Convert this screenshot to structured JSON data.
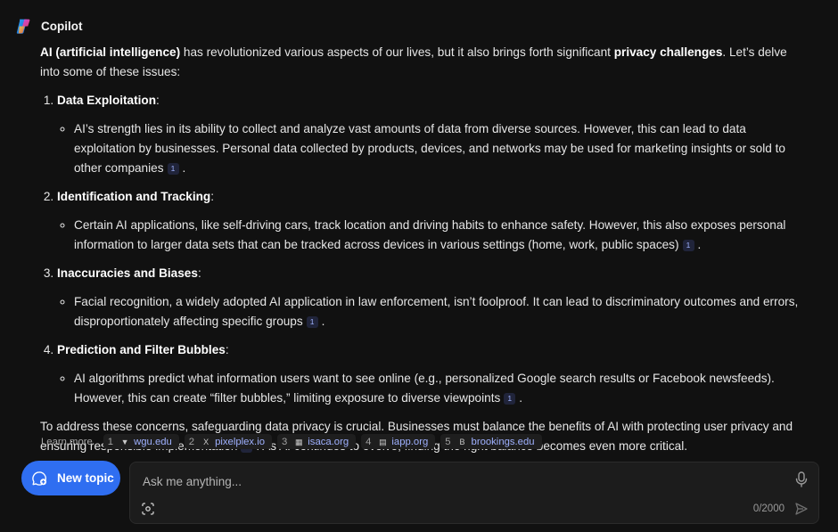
{
  "app": {
    "name": "Copilot"
  },
  "message": {
    "intro_bold1": "AI (artificial intelligence)",
    "intro_text1": " has revolutionized various aspects of our lives, but it also brings forth significant ",
    "intro_bold2": "privacy challenges",
    "intro_text2": ". Let’s delve into some of these issues:",
    "points": [
      {
        "title": "Data Exploitation",
        "detail": "AI’s strength lies in its ability to collect and analyze vast amounts of data from diverse sources. However, this can lead to data exploitation by businesses. Personal data collected by products, devices, and networks may be used for marketing insights or sold to other companies",
        "cite": "1"
      },
      {
        "title": "Identification and Tracking",
        "detail": "Certain AI applications, like self-driving cars, track location and driving habits to enhance safety. However, this also exposes personal information to larger data sets that can be tracked across devices in various settings (home, work, public spaces)",
        "cite": "1"
      },
      {
        "title": "Inaccuracies and Biases",
        "detail": "Facial recognition, a widely adopted AI application in law enforcement, isn’t foolproof. It can lead to discriminatory outcomes and errors, disproportionately affecting specific groups",
        "cite": "1"
      },
      {
        "title": "Prediction and Filter Bubbles",
        "detail": "AI algorithms predict what information users want to see online (e.g., personalized Google search results or Facebook newsfeeds). However, this can create “filter bubbles,” limiting exposure to diverse viewpoints",
        "cite": "1"
      }
    ],
    "closing_text1": "To address these concerns, safeguarding data privacy is crucial. Businesses must balance the benefits of AI with protecting user privacy and ensuring responsible implementation",
    "closing_cite": "2",
    "closing_text2": ". As AI continues to evolve, finding the right balance becomes even more critical."
  },
  "learn_more": {
    "label": "Learn more",
    "sources": [
      {
        "num": "1",
        "domain": "wgu.edu",
        "icon": "wgu-favicon",
        "glyph": "▼"
      },
      {
        "num": "2",
        "domain": "pixelplex.io",
        "icon": "pixelplex-favicon",
        "glyph": "X"
      },
      {
        "num": "3",
        "domain": "isaca.org",
        "icon": "isaca-favicon",
        "glyph": "▦"
      },
      {
        "num": "4",
        "domain": "iapp.org",
        "icon": "iapp-favicon",
        "glyph": "▤"
      },
      {
        "num": "5",
        "domain": "brookings.edu",
        "icon": "brookings-favicon",
        "glyph": "B"
      }
    ]
  },
  "new_topic": {
    "label": "New topic"
  },
  "composer": {
    "placeholder": "Ask me anything...",
    "char_count": "0/2000"
  },
  "colors": {
    "accent": "#2f6ef1",
    "background": "#111111",
    "citation": "#9fb3ff"
  }
}
